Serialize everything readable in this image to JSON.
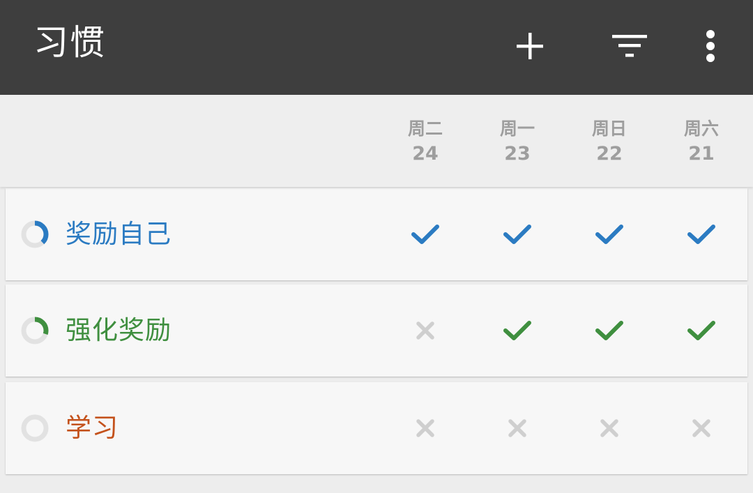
{
  "app_bar": {
    "title": "习惯",
    "actions": [
      "add-icon",
      "filter-icon",
      "more-vert-icon"
    ],
    "background": "#3e3e3e"
  },
  "days": [
    {
      "name": "周二",
      "num": "24"
    },
    {
      "name": "周一",
      "num": "23"
    },
    {
      "name": "周日",
      "num": "22"
    },
    {
      "name": "周六",
      "num": "21"
    }
  ],
  "habits": [
    {
      "name": "奖励自己",
      "color": "#2b7bc2",
      "progress": 0.38,
      "checks": [
        true,
        true,
        true,
        true
      ]
    },
    {
      "name": "强化奖励",
      "color": "#3f8f3f",
      "progress": 0.3,
      "checks": [
        false,
        true,
        true,
        true
      ]
    },
    {
      "name": "学习",
      "color": "#c4521c",
      "progress": 0,
      "checks": [
        false,
        false,
        false,
        false
      ]
    }
  ],
  "colors": {
    "unchecked": "#cfcfcf",
    "ring_track": "#e2e2e2",
    "day_label": "#9e9e9e"
  },
  "icons": {
    "checked": "check-icon",
    "unchecked": "x-icon"
  }
}
